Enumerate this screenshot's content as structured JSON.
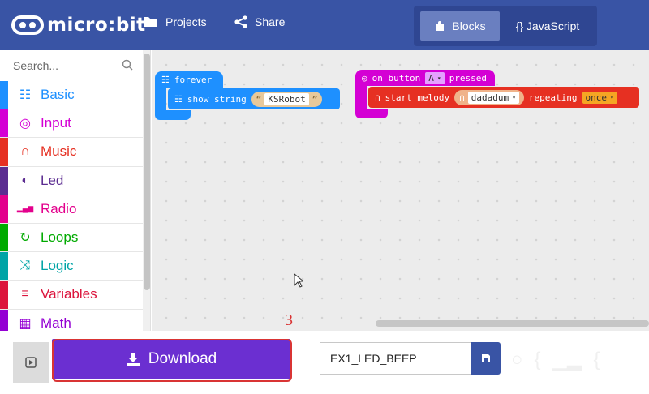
{
  "header": {
    "brand": "micro:bit",
    "projects_label": "Projects",
    "share_label": "Share",
    "blocks_label": "Blocks",
    "javascript_label": "{} JavaScript",
    "colors": {
      "header_bg": "#3954a5",
      "toggle_active": "#6a7fc0"
    }
  },
  "toolbox": {
    "search_placeholder": "Search...",
    "items": [
      {
        "label": "Basic",
        "color": "#1e90ff",
        "icon": "grid-icon"
      },
      {
        "label": "Input",
        "color": "#d400d4",
        "icon": "target-icon"
      },
      {
        "label": "Music",
        "color": "#e63022",
        "icon": "headphones-icon"
      },
      {
        "label": "Led",
        "color": "#5c2d91",
        "icon": "toggle-icon"
      },
      {
        "label": "Radio",
        "color": "#e3008c",
        "icon": "signal-icon"
      },
      {
        "label": "Loops",
        "color": "#00aa00",
        "icon": "loop-icon"
      },
      {
        "label": "Logic",
        "color": "#00a4a6",
        "icon": "shuffle-icon"
      },
      {
        "label": "Variables",
        "color": "#dc143c",
        "icon": "lines-icon"
      },
      {
        "label": "Math",
        "color": "#9400d3",
        "icon": "calculator-icon"
      }
    ]
  },
  "workspace": {
    "forever_block": {
      "label": "forever",
      "stmt_label": "show string",
      "string_value": "KSRobot",
      "color": "#1e90ff"
    },
    "button_block": {
      "label_before": "on button",
      "button_value": "A",
      "label_after": "pressed",
      "color": "#d400d4",
      "stmt_label": "start melody",
      "melody_value": "dadadum",
      "repeating_label": "repeating",
      "repeat_value": "once",
      "stmt_color": "#e63022"
    }
  },
  "bottom": {
    "download_label": "Download",
    "project_name": "EX1_LED_BEEP",
    "annotation_number": "3"
  }
}
